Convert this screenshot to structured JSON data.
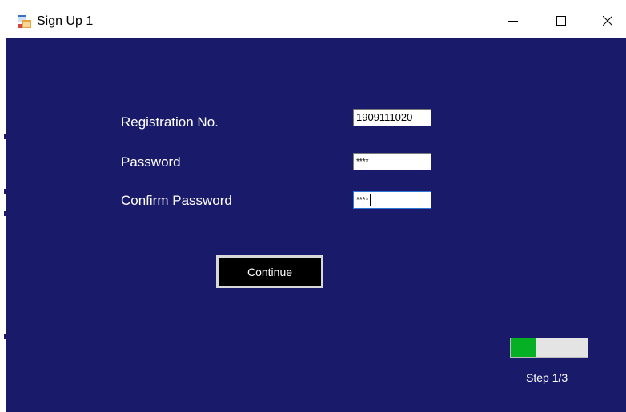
{
  "window": {
    "title": "Sign Up 1",
    "controls": {
      "minimize": "minimize",
      "maximize": "maximize",
      "close": "close"
    }
  },
  "form": {
    "registration": {
      "label": "Registration No.",
      "value": "1909111020"
    },
    "password": {
      "label": "Password",
      "value": "****"
    },
    "confirm_password": {
      "label": "Confirm Password",
      "value": "****"
    },
    "continue_label": "Continue"
  },
  "progress": {
    "step_text": "Step 1/3",
    "fraction": 0.333
  },
  "colors": {
    "background": "#1a1a6b",
    "progress_fill": "#06b025",
    "button_bg": "#000000",
    "focus_border": "#2f76d6"
  },
  "icons": {
    "app": "windows-form-icon",
    "minimize": "minimize-icon",
    "maximize": "maximize-icon",
    "close": "close-icon"
  }
}
